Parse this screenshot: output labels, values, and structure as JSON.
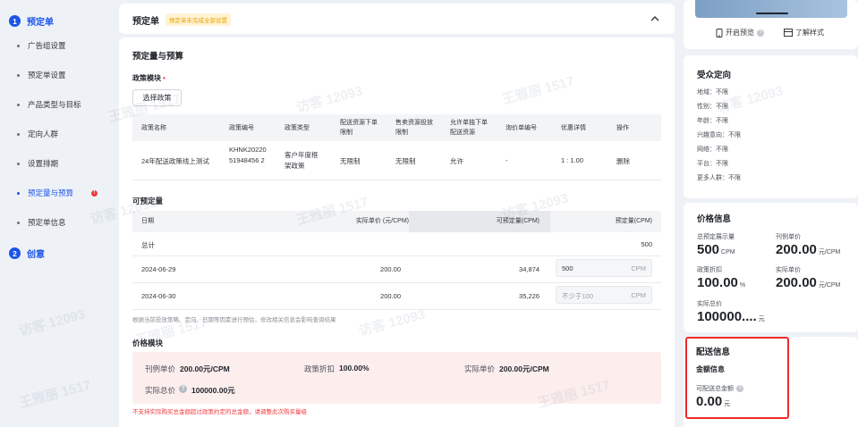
{
  "nav": {
    "step1": {
      "num": "1",
      "label": "预定单"
    },
    "items": [
      "广告组设置",
      "预定单设置",
      "产品类型与目标",
      "定向人群",
      "设置排期",
      "预定量与预算",
      "预定单信息"
    ],
    "error_mark": "!",
    "step2": {
      "num": "2",
      "label": "创意"
    }
  },
  "header": {
    "title": "预定单",
    "badge": "预定单未完成全部设置",
    "collapse_icon": "chevron-up"
  },
  "section": {
    "title": "预定量与预算",
    "policy_label": "政策模块",
    "required_mark": "•",
    "select_policy_button": "选择政策",
    "policy_table": {
      "headers": [
        "政策名称",
        "政策编号",
        "政策类型",
        "配送资源下单限制",
        "售卖资源投放限制",
        "允许单独下单配送资源",
        "询价单编号",
        "优惠详情",
        "操作"
      ],
      "row": [
        "24年配送政策线上测试",
        "KHNK2022051948456 2",
        "客户年度框架政策",
        "无限制",
        "无限制",
        "允许",
        "-",
        "1 : 1.00",
        "删除"
      ]
    },
    "bookable_title": "可预定量",
    "bookable_table": {
      "headers": [
        "日期",
        "实际单价 (元/CPM)",
        "可预定量(CPM)",
        "预定量(CPM)"
      ],
      "total_label": "总计",
      "total_value": "500",
      "rows": [
        {
          "date": "2024-06-29",
          "price": "200.00",
          "avail": "34,874",
          "input_value": "500",
          "input_placeholder": "",
          "unit": "CPM"
        },
        {
          "date": "2024-06-30",
          "price": "200.00",
          "avail": "35,226",
          "input_value": "",
          "input_placeholder": "不少于100",
          "unit": "CPM"
        }
      ]
    },
    "note": "根据当前投放策略、定向、日期等因素进行预估，修改相关信息会影响查询结果",
    "price_title": "价格模块",
    "price": {
      "list_label": "刊例单价",
      "list_value": "200.00元/CPM",
      "discount_label": "政策折扣",
      "discount_value": "100.00%",
      "actual_label": "实际单价",
      "actual_value": "200.00元/CPM",
      "total_label": "实际总价",
      "total_value": "100000.00元"
    },
    "error": "不支持实际购买总金额超过政策约定的总金额，请调整此次购买量级"
  },
  "right": {
    "preview_button": "开启预览",
    "style_link": "了解样式",
    "audience": {
      "title": "受众定向",
      "rows": [
        "地域：不限",
        "性别：不限",
        "年龄：不限",
        "兴趣意向：不限",
        "网络：不限",
        "平台：不限",
        "更多人群：不限"
      ]
    },
    "price_info": {
      "title": "价格信息",
      "total_booked_label": "总预定展示量",
      "total_booked_value": "500",
      "total_booked_unit": "CPM",
      "list_label": "刊例单价",
      "list_value": "200.00",
      "list_unit": "元/CPM",
      "discount_label": "政策折扣",
      "discount_value": "100.00",
      "discount_unit": "%",
      "actual_label": "实际单价",
      "actual_value": "200.00",
      "actual_unit": "元/CPM",
      "total_label": "实际总价",
      "total_value": "100000....",
      "total_unit": "元"
    },
    "delivery": {
      "title": "配送信息",
      "sub": "金额信息",
      "label": "可配送总金额",
      "value": "0.00",
      "unit": "元"
    }
  },
  "watermark": [
    "王雅丽 1517",
    "访客 12093"
  ],
  "colors": {
    "primary": "#1b54e8",
    "error": "#f0393c",
    "badge_bg": "#fff3d6",
    "badge_text": "#e8a300",
    "price_bg": "#fdeeee",
    "highlight_border": "#ef2a2a"
  }
}
